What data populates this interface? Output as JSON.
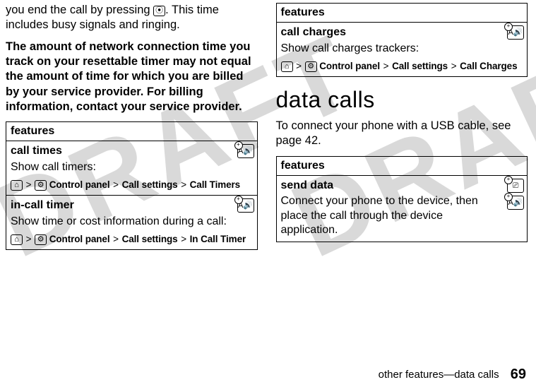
{
  "watermark": "DRAFT",
  "left": {
    "p1a": "you end the call by pressing ",
    "p1_key": "⦿",
    "p1b": ". This time includes busy signals and ringing.",
    "p2": "The amount of network connection time you track on your resettable timer may not equal the amount of time for which you are billed by your service provider. For billing information, contact your service provider.",
    "table_header": "features",
    "row1_title": "call times",
    "row1_body": "Show call timers:",
    "row1_path_a": "Control panel",
    "row1_path_b": "Call settings",
    "row1_path_c": "Call Timers",
    "row2_title": "in-call timer",
    "row2_body": "Show time or cost information during a call:",
    "row2_path_a": "Control panel",
    "row2_path_b": "Call settings",
    "row2_path_c": "In Call Timer"
  },
  "right": {
    "table1_header": "features",
    "r1_title": "call charges",
    "r1_body": "Show call charges trackers:",
    "r1_path_a": "Control panel",
    "r1_path_b": "Call settings",
    "r1_path_c": "Call Charges",
    "heading": "data calls",
    "p1": "To connect your phone with a USB cable, see page 42.",
    "table2_header": "features",
    "r2_title": "send data",
    "r2_body": "Connect your phone to the device, then place the call through the device application."
  },
  "icons": {
    "home": "⌂",
    "tools": "⚙",
    "badge_a": "A🔊",
    "badge_usb": "⎚"
  },
  "footer_label": "other features—data calls",
  "page_number": "69"
}
